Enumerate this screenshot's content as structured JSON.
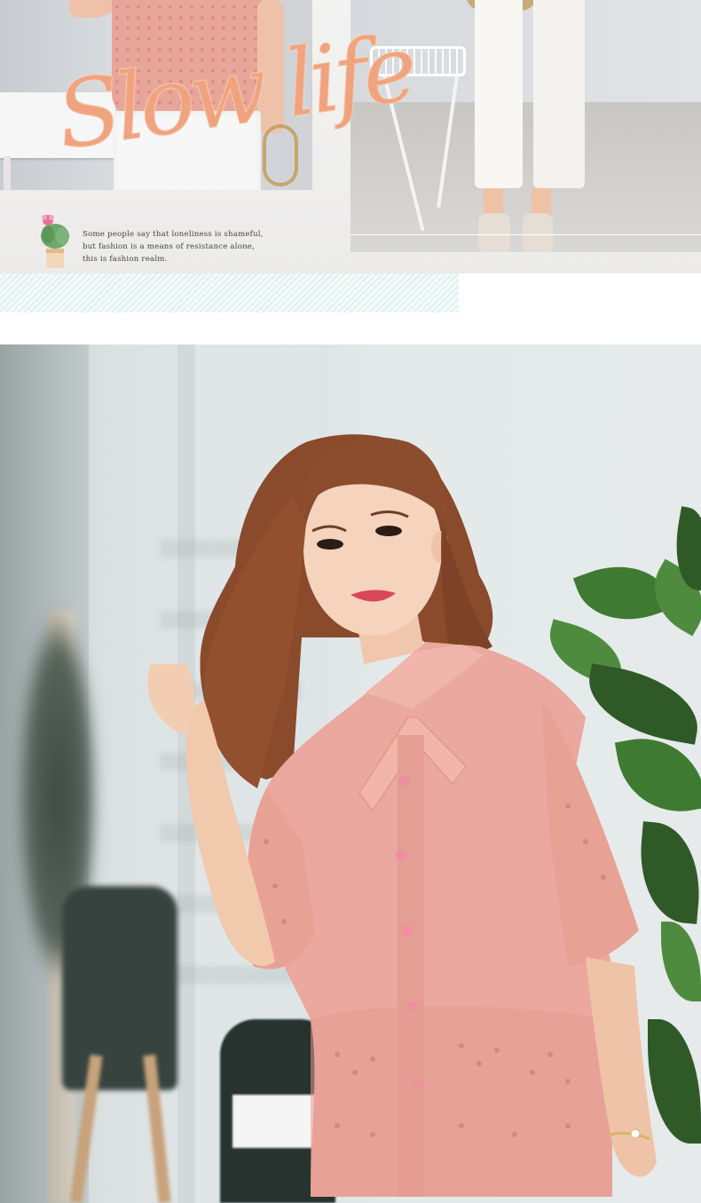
{
  "banner": {
    "headline": "Slow life",
    "quote_lines": [
      "Some people say that loneliness is shameful,",
      "but fashion is a means of resistance alone,",
      "this is fashion realm."
    ]
  },
  "colors": {
    "accent": "#f0a37f",
    "blouse_pink": "#eaa89e",
    "stripe_mint": "#dff1ef"
  },
  "icons": {
    "decoration": "cactus-icon"
  }
}
